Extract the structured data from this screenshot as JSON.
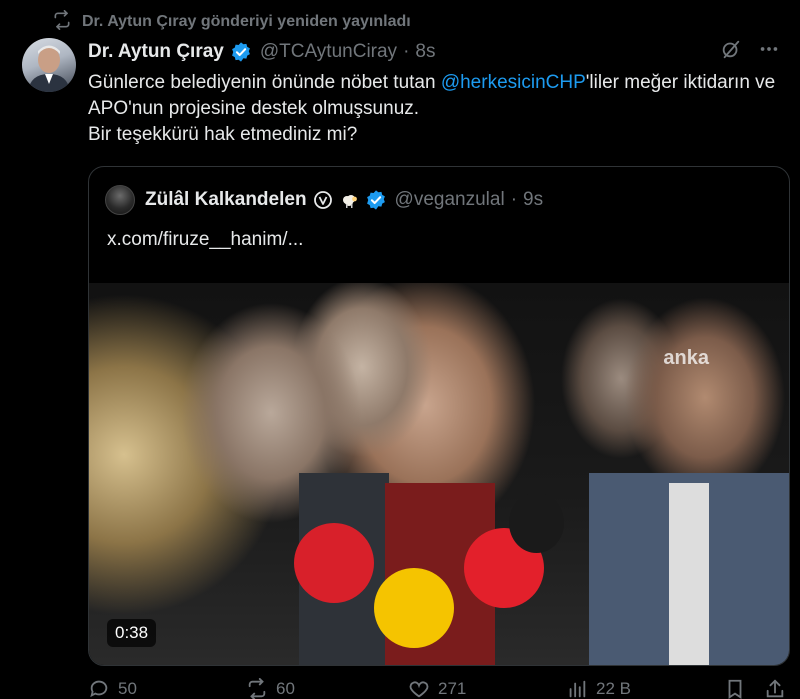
{
  "repost": {
    "text": "Dr. Aytun Çıray gönderiyi yeniden yayınladı"
  },
  "tweet": {
    "author_name": "Dr. Aytun Çıray",
    "handle": "@TCAytunCiray",
    "separator": "·",
    "time": "8s",
    "text_part1": "Günlerce belediyenin önünde nöbet tutan ",
    "mention": "@herkesicinCHP",
    "text_part2": "'liler meğer iktidarın ve APO'nun projesine destek olmuşsunuz.",
    "text_line3": "Bir teşekkürü hak etmediniz mi?"
  },
  "quote": {
    "author_name": "Zülâl Kalkandelen",
    "handle": "@veganzulal",
    "separator": "·",
    "time": "9s",
    "link": "x.com/firuze__hanim/...",
    "video": {
      "watermark": "anka",
      "timer": "0:38"
    }
  },
  "actions": {
    "replies": "50",
    "reposts": "60",
    "likes": "271",
    "views": "22 B"
  },
  "colors": {
    "background": "#000000",
    "text": "#e7e9ea",
    "muted": "#71767b",
    "accent": "#1d9bf0",
    "border": "#2f3336"
  },
  "icons": {
    "repost": "repost-icon",
    "verified": "verified-badge-icon",
    "grok": "grok-icon",
    "more": "more-icon",
    "reply": "reply-icon",
    "like": "heart-icon",
    "views": "views-icon",
    "bookmark": "bookmark-icon",
    "share": "share-icon"
  }
}
